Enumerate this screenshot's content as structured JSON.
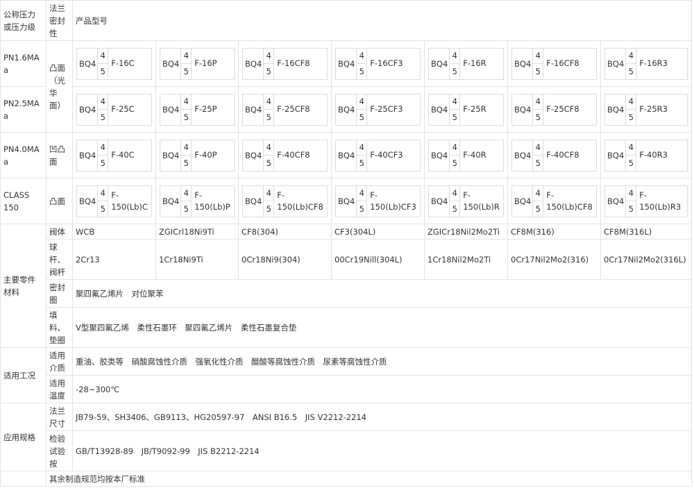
{
  "headers": {
    "pressure": "公称压力\n或压力级",
    "seal": "法兰\n密封\n性",
    "model": "产品型号"
  },
  "pressure_rows": [
    {
      "label": "PN1.6MAa",
      "models": [
        {
          "prefix": "BQ4",
          "top": "4",
          "bottom": "5",
          "suffix": "F-16C"
        },
        {
          "prefix": "BQ4",
          "top": "4",
          "bottom": "5",
          "suffix": "F-16P"
        },
        {
          "prefix": "BQ4",
          "top": "4",
          "bottom": "5",
          "suffix": "F-16CF8"
        },
        {
          "prefix": "BQ4",
          "top": "4",
          "bottom": "5",
          "suffix": "F-16CF3"
        },
        {
          "prefix": "BQ4",
          "top": "4",
          "bottom": "5",
          "suffix": "F-16R"
        },
        {
          "prefix": "BQ4",
          "top": "4",
          "bottom": "5",
          "suffix": "F-16CF8"
        },
        {
          "prefix": "BQ4",
          "top": "4",
          "bottom": "5",
          "suffix": "F-16R3"
        }
      ]
    },
    {
      "label": "PN2.5MAa",
      "models": [
        {
          "prefix": "BQ4",
          "top": "4",
          "bottom": "5",
          "suffix": "F-25C"
        },
        {
          "prefix": "BQ4",
          "top": "4",
          "bottom": "5",
          "suffix": "F-25P"
        },
        {
          "prefix": "BQ4",
          "top": "4",
          "bottom": "5",
          "suffix": "F-25CF8"
        },
        {
          "prefix": "BQ4",
          "top": "4",
          "bottom": "5",
          "suffix": "F-25CF3"
        },
        {
          "prefix": "BQ4",
          "top": "4",
          "bottom": "5",
          "suffix": "F-25R"
        },
        {
          "prefix": "BQ4",
          "top": "4",
          "bottom": "5",
          "suffix": "F-25CF8"
        },
        {
          "prefix": "BQ4",
          "top": "4",
          "bottom": "5",
          "suffix": "F-25R3"
        }
      ]
    },
    {
      "label": "PN4.0MAa",
      "models": [
        {
          "prefix": "BQ4",
          "top": "4",
          "bottom": "5",
          "suffix": "F-40C"
        },
        {
          "prefix": "BQ4",
          "top": "4",
          "bottom": "5",
          "suffix": "F-40P"
        },
        {
          "prefix": "BQ4",
          "top": "4",
          "bottom": "5",
          "suffix": "F-40CF8"
        },
        {
          "prefix": "BQ4",
          "top": "4",
          "bottom": "5",
          "suffix": "F-40CF3"
        },
        {
          "prefix": "BQ4",
          "top": "4",
          "bottom": "5",
          "suffix": "F-40R"
        },
        {
          "prefix": "BQ4",
          "top": "4",
          "bottom": "5",
          "suffix": "F-40CF8"
        },
        {
          "prefix": "BQ4",
          "top": "4",
          "bottom": "5",
          "suffix": "F-40R3"
        }
      ]
    },
    {
      "label": "CLASS\n150",
      "models": [
        {
          "prefix": "BQ4",
          "top": "4",
          "bottom": "5",
          "suffix": "F-\n150(Lb)C"
        },
        {
          "prefix": "BQ4",
          "top": "4",
          "bottom": "5",
          "suffix": "F-\n150(Lb)P"
        },
        {
          "prefix": "BQ4",
          "top": "4",
          "bottom": "5",
          "suffix": "F-\n150(Lb)CF8"
        },
        {
          "prefix": "BQ4",
          "top": "4",
          "bottom": "5",
          "suffix": "F-\n150(Lb)CF3"
        },
        {
          "prefix": "BQ4",
          "top": "4",
          "bottom": "5",
          "suffix": "F-\n150(Lb)R"
        },
        {
          "prefix": "BQ4",
          "top": "4",
          "bottom": "5",
          "suffix": "F-\n150(Lb)CF8"
        },
        {
          "prefix": "BQ4",
          "top": "4",
          "bottom": "5",
          "suffix": "F-\n150(Lb)R3"
        }
      ]
    }
  ],
  "seal_types": {
    "raised": "凸面（光\n华\n面）",
    "tongue": "凹凸\n面",
    "class_raised": "凸面"
  },
  "materials": {
    "group_label": "主要零件\n材料",
    "body": {
      "label": "阀体",
      "values": [
        "WCB",
        "ZGICrl18Ni9Ti",
        "CF8(304)",
        "CF3(304L)",
        "ZGICr18Nil2Mo2Ti",
        "CF8M(316)",
        "CF8M(316L)"
      ]
    },
    "stem": {
      "label": "球\n杆、\n阀杆",
      "values": [
        "2Cr13",
        "1Cr18Ni9Ti",
        "0Cr18Ni9(304)",
        "00Cr19Nill(304L)",
        "1Cr18Nil2Mo2Ti",
        "0Cr17Nil2Mo2(316)",
        "0Cr17Nil2Mo2(316L)"
      ]
    },
    "seal_ring": {
      "label": "密封\n圈",
      "value": "聚四氟乙烯片　对位聚苯"
    },
    "packing": {
      "label": "填\n料、\n垫圈",
      "value": "V型聚四氟乙烯　柔性石墨环　聚四氟乙烯片　柔性石墨复合垫"
    }
  },
  "conditions": {
    "group_label": "适用工况",
    "medium": {
      "label": "适用\n介质",
      "value": "重油、胶类等　硝酸腐蚀性介质　强氧化性介质　醋酸等腐蚀性介质　尿素等腐蚀性介质"
    },
    "temperature": {
      "label": "适用\n温度",
      "value": "-28~300℃"
    }
  },
  "standards": {
    "group_label": "应用规格",
    "flange": {
      "label": "法兰\n尺寸",
      "value": "JB79-59、SH3406、GB9113、HG20597-97　ANSI B16.5　JIS V2212-2214"
    },
    "inspection": {
      "label": "检验\n试验\n按",
      "value": "GB/T13928-89　JB/T9092-99　JIS B2212-2214"
    }
  },
  "footer": "其余制造规范均按本厂标准",
  "colors": {
    "border": "#e3e3e3",
    "text": "#333333",
    "background": "#ffffff"
  }
}
